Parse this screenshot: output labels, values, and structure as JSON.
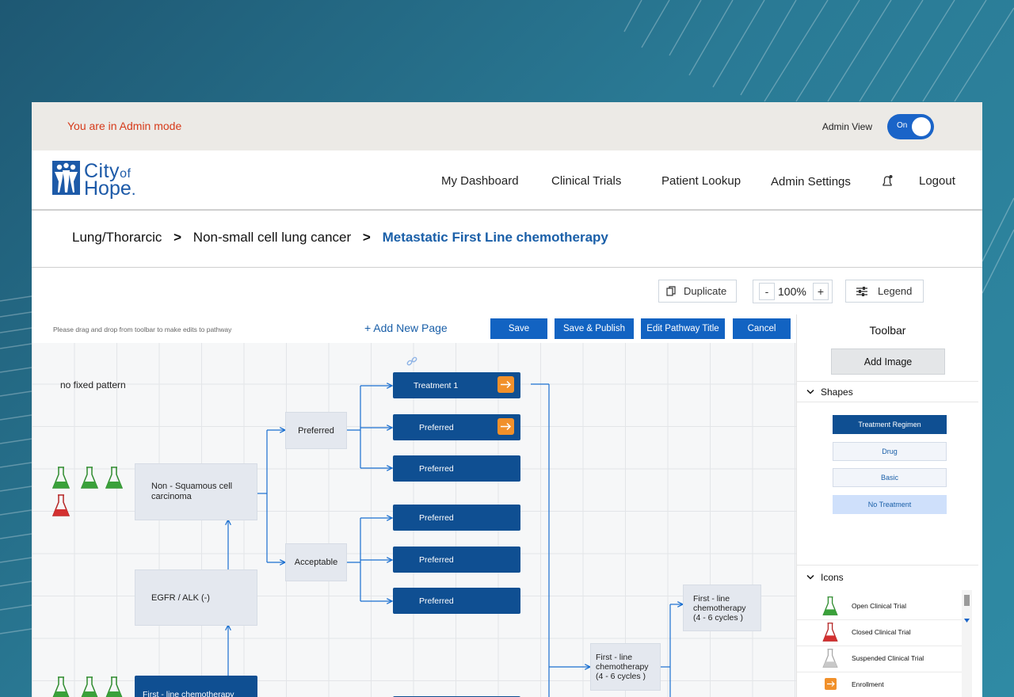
{
  "admin_bar": {
    "message": "You are in Admin mode",
    "view_label": "Admin View",
    "toggle_label": "On"
  },
  "logo": {
    "city": "City",
    "of": "of",
    "hope": "Hope",
    "mark": "."
  },
  "nav": {
    "items": [
      "My Dashboard",
      "Clinical Trials",
      "Patient Lookup",
      "Admin Settings",
      "Logout"
    ]
  },
  "breadcrumb": {
    "items": [
      "Lung/Thorarcic",
      "Non-small cell lung cancer",
      "Metastatic First Line chemotherapy"
    ]
  },
  "toolbar": {
    "duplicate": "Duplicate",
    "zoom_minus": "-",
    "zoom_value": "100%",
    "zoom_plus": "+",
    "legend": "Legend"
  },
  "editor": {
    "hint": "Please drag and drop from toolbar to make edits to pathway",
    "add_page": "+ Add New Page",
    "save": "Save",
    "save_publish": "Save & Publish",
    "edit_title": "Edit Pathway Title",
    "cancel": "Cancel"
  },
  "canvas": {
    "pattern_label": "no fixed pattern",
    "nodes": {
      "non_squamous": "Non - Squamous cell carcinoma",
      "egfr": "EGFR / ALK (-)",
      "first_line_bottom": "First - line chemotherapy",
      "preferred_group": "Preferred",
      "acceptable_group": "Acceptable",
      "treatment1": "Treatment 1",
      "preferred": "Preferred",
      "chemo_top": "First - line chemotherapy (4 - 6 cycles )",
      "chemo_mid": "First - line chemotherapy (4 - 6 cycles )"
    }
  },
  "panel": {
    "title": "Toolbar",
    "add_image": "Add Image",
    "shapes_title": "Shapes",
    "shapes": [
      "Treatment Regimen",
      "Drug",
      "Basic",
      "No Treatment"
    ],
    "icons_title": "Icons",
    "icons": [
      "Open Clinical Trial",
      "Closed Clinical Trial",
      "Suspended Clinical Trial",
      "Enrollment"
    ]
  },
  "colors": {
    "brand": "#1d5aa8",
    "node_blue": "#0f4f92",
    "button_blue": "#1263c2",
    "open_trial": "#3aa13a",
    "closed_trial": "#d33030",
    "suspended_trial": "#c8c8c8",
    "enrollment": "#f1902a"
  }
}
